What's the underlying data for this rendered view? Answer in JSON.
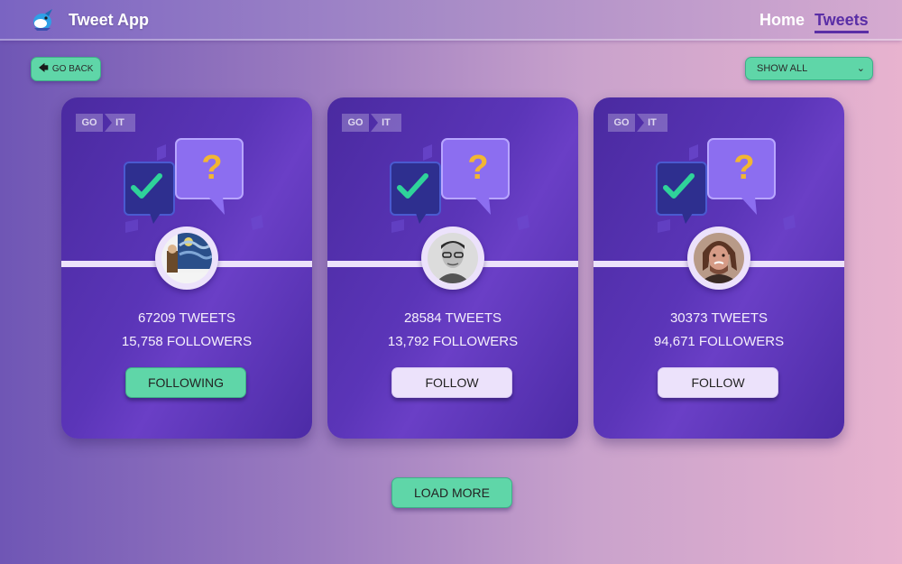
{
  "header": {
    "app_title": "Tweet App",
    "nav_home": "Home",
    "nav_tweets": "Tweets",
    "logo_icon": "bird-logo-icon"
  },
  "toolbar": {
    "go_back_label": "GO BACK",
    "go_back_icon": "arrow-left-icon",
    "filter_selected": "SHOW ALL"
  },
  "cards": [
    {
      "logo_go": "GO",
      "logo_it": "IT",
      "tweets": "67209 TWEETS",
      "followers": "15,758 FOLLOWERS",
      "button_label": "FOLLOWING",
      "button_state": "following"
    },
    {
      "logo_go": "GO",
      "logo_it": "IT",
      "tweets": "28584 TWEETS",
      "followers": "13,792 FOLLOWERS",
      "button_label": "FOLLOW",
      "button_state": "follow"
    },
    {
      "logo_go": "GO",
      "logo_it": "IT",
      "tweets": "30373 TWEETS",
      "followers": "94,671 FOLLOWERS",
      "button_label": "FOLLOW",
      "button_state": "follow"
    }
  ],
  "footer": {
    "load_more_label": "LOAD MORE"
  },
  "colors": {
    "accent_green": "#5fd6a8",
    "card_purple": "#5b35b8",
    "light_lilac": "#ece2fb",
    "active_nav": "#5a2ea6"
  }
}
